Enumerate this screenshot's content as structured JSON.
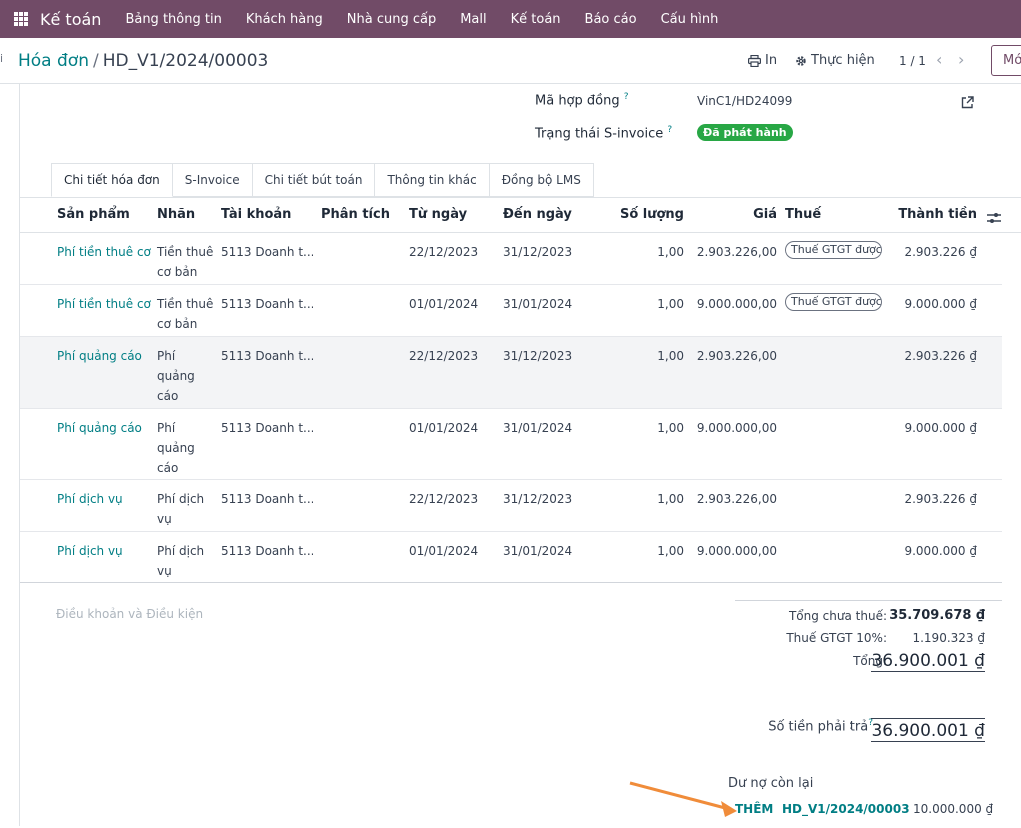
{
  "topbar": {
    "app_name": "Kế toán",
    "menu": [
      "Bảng thông tin",
      "Khách hàng",
      "Nhà cung cấp",
      "Mall",
      "Kế toán",
      "Báo cáo",
      "Cấu hình"
    ]
  },
  "control": {
    "left_stub": "i",
    "breadcrumb_root": "Hóa đơn",
    "breadcrumb_sep": "/",
    "breadcrumb_current": "HD_V1/2024/00003",
    "print_label": "In",
    "action_label": "Thực hiện",
    "pager": "1 / 1",
    "new_label": "Mới"
  },
  "fields": {
    "contract_label": "Mã hợp đồng",
    "contract_value": "VinC1/HD24099",
    "sinvoice_label": "Trạng thái S-invoice",
    "sinvoice_status": "Đã phát hành",
    "help_mark": "?"
  },
  "tabs": [
    "Chi tiết hóa đơn",
    "S-Invoice",
    "Chi tiết bút toán",
    "Thông tin khác",
    "Đồng bộ LMS"
  ],
  "columns": {
    "product": "Sản phẩm",
    "label": "Nhãn",
    "account": "Tài khoản",
    "analytic": "Phân tích",
    "from": "Từ ngày",
    "to": "Đến ngày",
    "qty": "Số lượng",
    "price": "Giá",
    "tax": "Thuế",
    "total": "Thành tiền"
  },
  "rows": [
    {
      "product": "Phí tiền thuê cơ bản",
      "label": "Tiền thuê cơ bản",
      "account": "5113 Doanh t...",
      "from": "22/12/2023",
      "to": "31/12/2023",
      "qty": "1,00",
      "price": "2.903.226,00",
      "tax": "Thuế GTGT được",
      "total": "2.903.226 ₫"
    },
    {
      "product": "Phí tiền thuê cơ bản",
      "label": "Tiền thuê cơ bản",
      "account": "5113 Doanh t...",
      "from": "01/01/2024",
      "to": "31/01/2024",
      "qty": "1,00",
      "price": "9.000.000,00",
      "tax": "Thuế GTGT được",
      "total": "9.000.000 ₫"
    },
    {
      "product": "Phí quảng cáo",
      "label": "Phí quảng cáo",
      "account": "5113 Doanh t...",
      "from": "22/12/2023",
      "to": "31/12/2023",
      "qty": "1,00",
      "price": "2.903.226,00",
      "tax": "",
      "total": "2.903.226 ₫"
    },
    {
      "product": "Phí quảng cáo",
      "label": "Phí quảng cáo",
      "account": "5113 Doanh t...",
      "from": "01/01/2024",
      "to": "31/01/2024",
      "qty": "1,00",
      "price": "9.000.000,00",
      "tax": "",
      "total": "9.000.000 ₫"
    },
    {
      "product": "Phí dịch vụ",
      "label": "Phí dịch vụ",
      "account": "5113 Doanh t...",
      "from": "22/12/2023",
      "to": "31/12/2023",
      "qty": "1,00",
      "price": "2.903.226,00",
      "tax": "",
      "total": "2.903.226 ₫"
    },
    {
      "product": "Phí dịch vụ",
      "label": "Phí dịch vụ",
      "account": "5113 Doanh t...",
      "from": "01/01/2024",
      "to": "31/01/2024",
      "qty": "1,00",
      "price": "9.000.000,00",
      "tax": "",
      "total": "9.000.000 ₫"
    }
  ],
  "terms_placeholder": "Điều khoản và Điều kiện",
  "totals": {
    "untaxed_label": "Tổng chưa thuế:",
    "untaxed_value": "35.709.678 ₫",
    "vat_label": "Thuế GTGT 10%:",
    "vat_value": "1.190.323 ₫",
    "total_label": "Tổng:",
    "total_value": "36.900.001 ₫",
    "due_label": "Số tiền phải trả",
    "due_colon": ":",
    "due_value": "36.900.001 ₫"
  },
  "outstanding": {
    "title": "Dư nợ còn lại",
    "add_label": "THÊM",
    "ref": "HD_V1/2024/00003",
    "amount": "10.000.000 ₫"
  },
  "colors": {
    "topbar": "#714b67",
    "link": "#017e84",
    "badge": "#28a745",
    "arrow": "#f08c3a"
  }
}
